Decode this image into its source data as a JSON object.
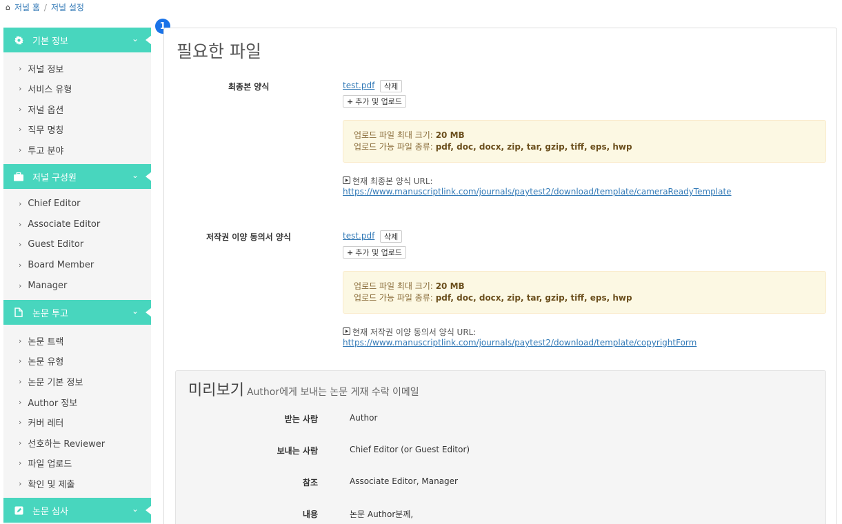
{
  "breadcrumb": {
    "home": "저널 홈",
    "separator": "/",
    "current": "저널 설정"
  },
  "badge": "1",
  "sidebar": {
    "sections": [
      {
        "title": "기본 정보",
        "icon": "gear-icon",
        "items": [
          "저널 정보",
          "서비스 유형",
          "저널 옵션",
          "직무 명칭",
          "투고 분야"
        ]
      },
      {
        "title": "저널 구성원",
        "icon": "briefcase-icon",
        "items": [
          "Chief Editor",
          "Associate Editor",
          "Guest Editor",
          "Board Member",
          "Manager"
        ]
      },
      {
        "title": "논문 투고",
        "icon": "document-icon",
        "items": [
          "논문 트랙",
          "논문 유형",
          "논문 기본 정보",
          "Author 정보",
          "커버 레터",
          "선호하는 Reviewer",
          "파일 업로드",
          "확인 및 제출"
        ]
      },
      {
        "title": "논문 심사",
        "icon": "edit-icon",
        "items": []
      }
    ]
  },
  "main": {
    "title": "필요한 파일",
    "files": [
      {
        "label": "최종본 양식",
        "filename": "test.pdf",
        "delete_label": "삭제",
        "upload_label": "추가 및 업로드",
        "notice_size_label": "업로드 파일 최대 크기:",
        "notice_size_value": "20 MB",
        "notice_types_label": "업로드 가능 파일 종류:",
        "notice_types_value": "pdf, doc, docx, zip, tar, gzip, tiff, eps, hwp",
        "url_label": "현재 최종본 양식 URL:",
        "url": "https://www.manuscriptlink.com/journals/paytest2/download/template/cameraReadyTemplate"
      },
      {
        "label": "저작권 이양 동의서 양식",
        "filename": "test.pdf",
        "delete_label": "삭제",
        "upload_label": "추가 및 업로드",
        "notice_size_label": "업로드 파일 최대 크기:",
        "notice_size_value": "20 MB",
        "notice_types_label": "업로드 가능 파일 종류:",
        "notice_types_value": "pdf, doc, docx, zip, tar, gzip, tiff, eps, hwp",
        "url_label": "현재 저작권 이양 동의서 양식 URL:",
        "url": "https://www.manuscriptlink.com/journals/paytest2/download/template/copyrightForm"
      }
    ],
    "preview": {
      "title": "미리보기",
      "subtitle": "Author에게 보내는 논문 게재 수락 이메일",
      "rows": [
        {
          "label": "받는 사람",
          "value": "Author"
        },
        {
          "label": "보내는 사람",
          "value": "Chief Editor (or Guest Editor)"
        },
        {
          "label": "참조",
          "value": "Associate Editor, Manager"
        },
        {
          "label": "내용",
          "value": "논문 Author분께,"
        }
      ]
    }
  }
}
